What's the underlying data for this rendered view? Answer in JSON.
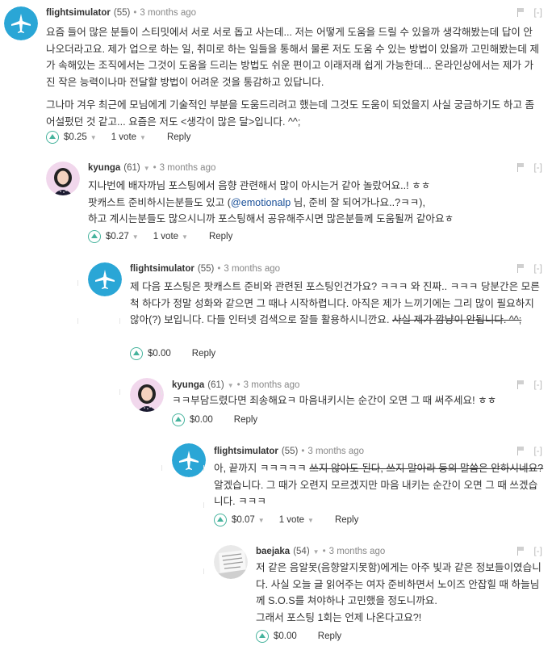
{
  "comments": [
    {
      "author": "flightsimulator",
      "rep": "(55)",
      "ago": "3 months ago",
      "paragraphs": [
        "요즘 들어 많은 분들이 스티밋에서 서로 서로 돕고 사는데... 저는 어떻게 도움을 드릴 수 있을까 생각해봤는데 답이 안나오더라고요. 제가 업으로 하는 일, 취미로 하는 일들을 통해서 물론 저도 도움 수 있는 방법이 있을까 고민해봤는데 제가 속해있는 조직에서는 그것이 도움을 드리는 방법도 쉬운 편이고 이래저래 쉽게 가능한데... 온라인상에서는 제가 가진 작은 능력이나마 전달할 방법이 어려운 것을 통감하고 있답니다.",
        "그나마 겨우 최근에 모님에게 기술적인 부분을 도움드리려고 했는데 그것도 도움이 되었을지 사실 궁금하기도 하고 좀 어설펐던 것 같고... 요즘은 저도 <생각이 많은 달>입니다. ^^;"
      ],
      "payout": "$0.25",
      "votes": "1 vote",
      "reply": "Reply"
    },
    {
      "author": "kyunga",
      "rep": "(61)",
      "ago": "3 months ago",
      "line1": "지나번에 배자까님 포스팅에서 음향 관련해서 많이 아시는거 같아 놀랐어요..! ㅎㅎ",
      "line2_pre": "팟캐스트 준비하시는분들도 있고 (",
      "mention": "@emotionalp",
      "line2_post": " 님, 준비 잘 되어가나요..?ㅋㅋ),",
      "line3": "하고 계시는분들도 많으시니까 포스팅해서 공유해주시면 많은분들께 도움될꺼 같아요ㅎ",
      "payout": "$0.27",
      "votes": "1 vote",
      "reply": "Reply"
    },
    {
      "author": "flightsimulator",
      "rep": "(55)",
      "ago": "3 months ago",
      "text": "제 다음 포스팅은 팟캐스트 준비와 관련된 포스팅인건가요? ㅋㅋㅋ 와 진짜.. ㅋㅋㅋ 당분간은 모른척 하다가 정말 성화와 같으면 그 때나 시작하렵니다. 아직은 제가 느끼기에는 그리 많이 필요하지 않아(?) 보입니다. 다들 인터넷 검색으로 잘들 활용하시니깐요. ",
      "strike": "사실 제가 깜냥이 안됩니다. ^^;",
      "payout": "$0.00",
      "reply": "Reply"
    },
    {
      "author": "kyunga",
      "rep": "(61)",
      "ago": "3 months ago",
      "text": "ㅋㅋ부담드렸다면 죄송해요ㅋ 마음내키시는 순간이 오면 그 때 써주세요! ㅎㅎ",
      "payout": "$0.00",
      "reply": "Reply"
    },
    {
      "author": "flightsimulator",
      "rep": "(55)",
      "ago": "3 months ago",
      "pre": "아, 끝까지 ㅋㅋㅋㅋㅋ ",
      "strike": "쓰지 않아도 된다, 쓰지 말아라 등의 말씀은 안하시네요?",
      "post": " 알겠습니다. 그 때가 오련지 모르겠지만 마음 내키는 순간이 오면 그 때 쓰겠습니다. ㅋㅋㅋ",
      "payout": "$0.07",
      "votes": "1 vote",
      "reply": "Reply"
    },
    {
      "author": "baejaka",
      "rep": "(54)",
      "ago": "3 months ago",
      "line1": "저 같은 음알못(음향알지못함)에게는 아주 빛과 같은 정보들이였습니다. 사실 오늘 글 읽어주는 여자 준비하면서 노이즈 안잡힐 때 하늘님께 S.O.S를 쳐야하나 고민했을 정도니까요.",
      "line2": "그래서 포스팅 1회는 언제 나온다고요?!",
      "payout": "$0.00",
      "reply": "Reply"
    }
  ],
  "controls": {
    "collapse": "[-]"
  },
  "colors": {
    "accent": "#46b39d",
    "mention": "#1a5099"
  }
}
